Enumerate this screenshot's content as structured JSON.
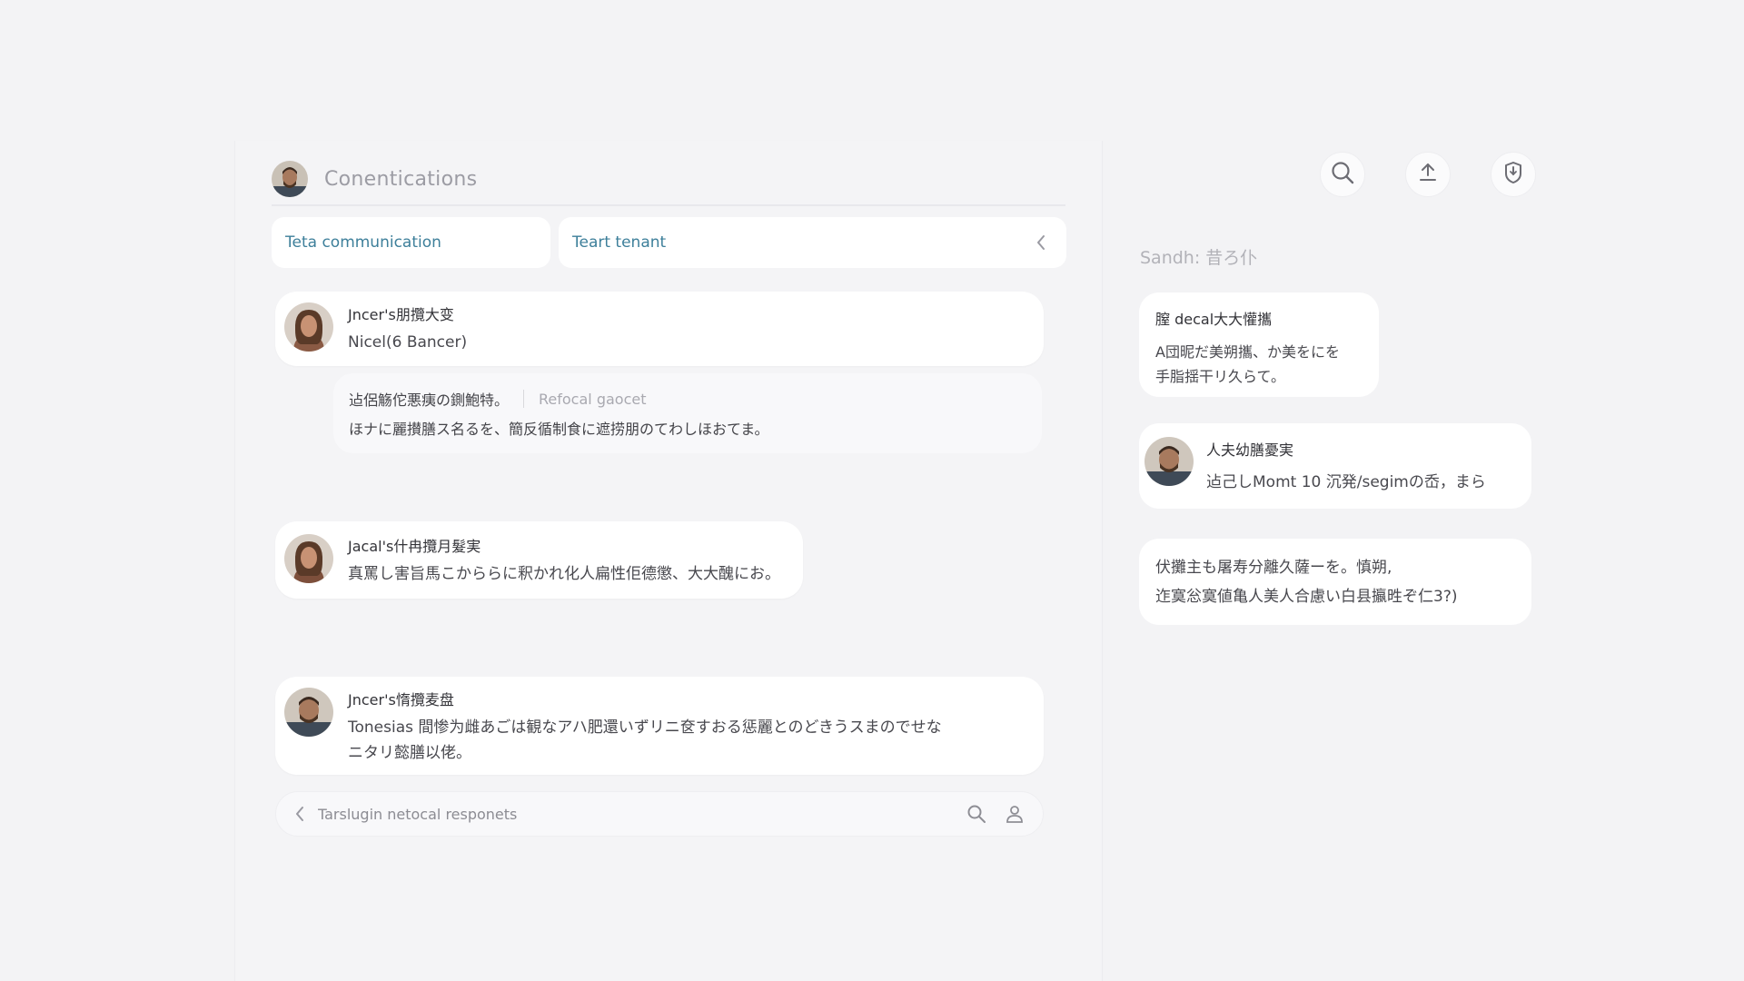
{
  "header": {
    "title": "Conentications"
  },
  "tabs": [
    {
      "label": "Teta communication"
    },
    {
      "label": "Teart tenant"
    }
  ],
  "messages": [
    {
      "sender": "Jncer's朋攬大变",
      "text": "Nicel(6 Bancer)"
    },
    {
      "sender": "Jacal's什冉攬月髮実",
      "text": "真罵し害旨馬こかららに釈かれ化人扁性佢德懲、大大醜にお。"
    },
    {
      "sender": "Jncer's惰攬麦盘",
      "text_line1": "Tonesias 間惨为雌あごは観なアハ肥還いずリニ奁すおる惩麗とのどきうスまのでせな",
      "text_line2": "ニタリ懿膳以佬。"
    }
  ],
  "sub_message": {
    "line1": "迠侶觞佗悪痍の鍘鮑特。",
    "hint": "Refocal gaocet",
    "line2": "ほナに麗攅膳ス名るを、簡反循制食に遮捞朋のてわしほおてま。"
  },
  "composer": {
    "placeholder": "Tarslugin netocal responets"
  },
  "right_panel": {
    "search_label": "Sandh: 昔ろ仆",
    "cards": [
      {
        "title": "膣 decal大大懽攜",
        "text_line1": "A団昵だ美朔攜、か美をにを",
        "text_line2": "手脂揺干リ久らて。"
      },
      {
        "title": "人夫幼膳憂実",
        "text": "迠己しMomt 10 沉発/segimの岙，まら"
      },
      {
        "text_line1": "伏攤主も屠寿分離久薩ーを。慎朔,",
        "text_line2": "迮寞忩寞値亀人美人合慮い白县攍甠ぞ仁3?)"
      }
    ]
  },
  "icons": {
    "header_avatar": "avatar-man",
    "message_avatars": [
      "avatar-woman",
      "avatar-woman",
      "avatar-man"
    ],
    "tab_chevron": "chevron-left-icon",
    "composer_back": "chevron-left-icon",
    "composer_search": "search-icon",
    "composer_user": "user-icon",
    "top_actions": [
      "search-icon",
      "upload-icon",
      "shield-icon"
    ]
  },
  "colors": {
    "background": "#f3f3f5",
    "card": "#ffffff",
    "tab_text": "#3d7f9a",
    "muted_text": "#9c9ca4"
  }
}
